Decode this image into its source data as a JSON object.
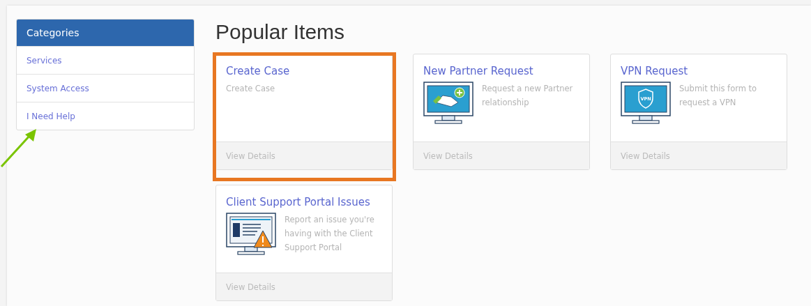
{
  "sidebar": {
    "title": "Categories",
    "items": [
      {
        "label": "Services",
        "pointed": false
      },
      {
        "label": "System Access",
        "pointed": false
      },
      {
        "label": "I Need Help",
        "pointed": true
      }
    ]
  },
  "heading": "Popular Items",
  "cards": [
    {
      "title": "Create Case",
      "description": "Create Case",
      "kind": "plain",
      "footer": "View Details",
      "highlighted": true
    },
    {
      "title": "New Partner Request",
      "description": "Request a new Partner relationship",
      "kind": "handshake",
      "footer": "View Details",
      "highlighted": false
    },
    {
      "title": "VPN Request",
      "description": "Submit this form to request a VPN",
      "kind": "vpn",
      "icon_label": "VPN",
      "footer": "View Details",
      "highlighted": false
    },
    {
      "title": "Client Support Portal Issues",
      "description": "Report an issue you're having with the Client Support Portal",
      "kind": "warning",
      "footer": "View Details",
      "highlighted": false
    }
  ]
}
